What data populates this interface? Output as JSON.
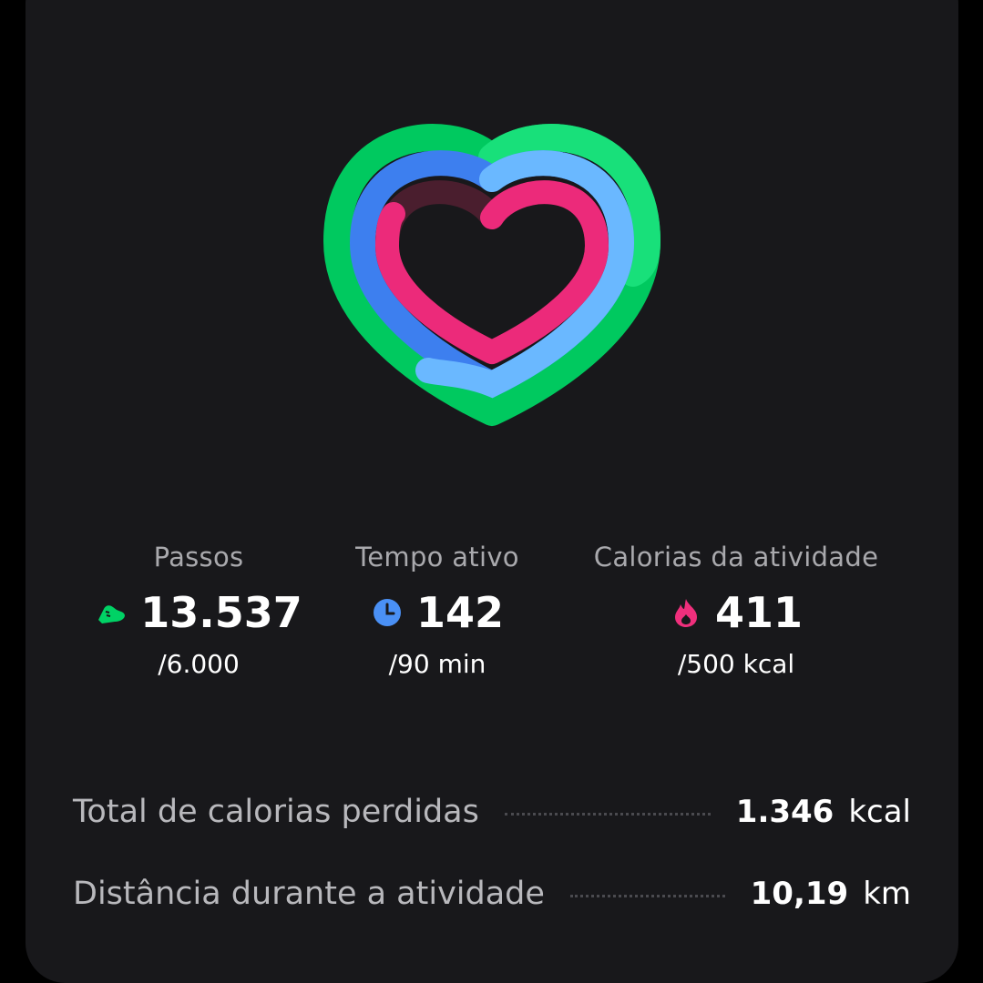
{
  "colors": {
    "steps": "#00d265",
    "active_time": "#4a90f5",
    "calories": "#ef2f7c",
    "card_bg": "#18181b"
  },
  "progress": {
    "steps_fraction": 2.256,
    "active_time_fraction": 1.578,
    "calories_fraction": 0.822
  },
  "stats": [
    {
      "label": "Passos",
      "value": "13.537",
      "goal": "/6.000",
      "icon": "shoe-icon"
    },
    {
      "label": "Tempo ativo",
      "value": "142",
      "goal": "/90 min",
      "icon": "clock-icon"
    },
    {
      "label": "Calorias da atividade",
      "value": "411",
      "goal": "/500 kcal",
      "icon": "flame-icon"
    }
  ],
  "details": [
    {
      "label": "Total de calorias perdidas",
      "value": "1.346",
      "unit": "kcal"
    },
    {
      "label": "Distância durante a atividade",
      "value": "10,19",
      "unit": "km"
    }
  ]
}
